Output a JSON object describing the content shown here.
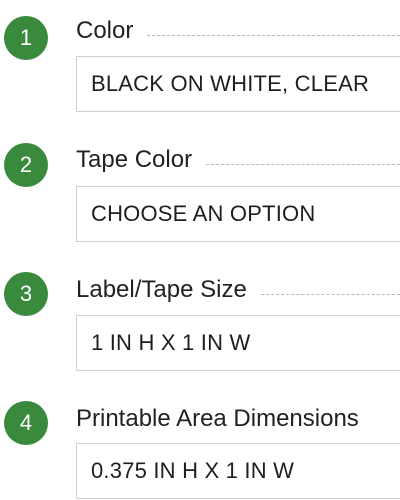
{
  "accent_color": "#3a8a3e",
  "steps": [
    {
      "number": "1",
      "label": "Color",
      "value": "BLACK ON WHITE, CLEAR"
    },
    {
      "number": "2",
      "label": "Tape Color",
      "value": "CHOOSE AN OPTION"
    },
    {
      "number": "3",
      "label": "Label/Tape Size",
      "value": "1 IN H X 1 IN W"
    },
    {
      "number": "4",
      "label": "Printable Area Dimensions",
      "value": "0.375 IN H X 1 IN W"
    }
  ]
}
